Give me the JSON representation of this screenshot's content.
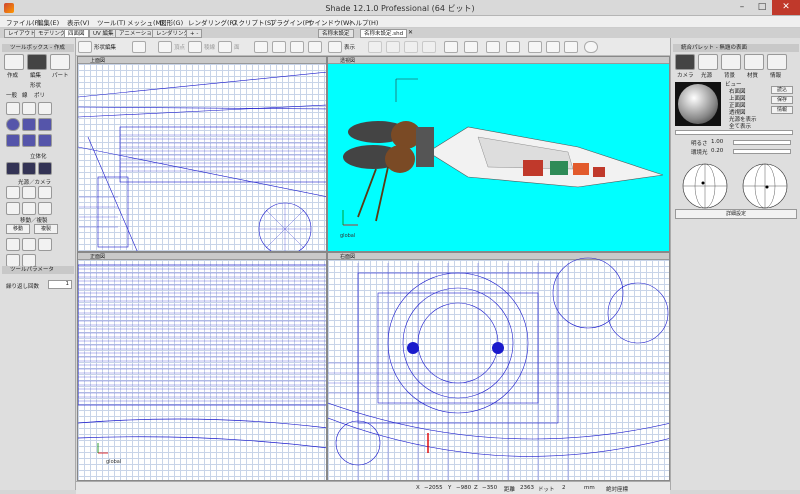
{
  "window": {
    "title": "Shade 12.1.0 Professional (64 ビット)"
  },
  "menu": [
    "ファイル(F)",
    "編集(E)",
    "表示(V)",
    "ツール(T)",
    "メッシュ(M)",
    "図形(G)",
    "レンダリング(R)",
    "スクリプト(S)",
    "プラグイン(P)",
    "ウインドウ(W)",
    "ヘルプ(H)"
  ],
  "tabs": {
    "left": [
      "レイアウト",
      "モデリング",
      "四面図",
      "UV 編集",
      "アニメーション",
      "レンダリング",
      "+ -"
    ],
    "doc": [
      "名称未設定",
      "名称未設定.shd"
    ]
  },
  "toolbar": {
    "shape_edit": "形状編集",
    "top_label": "頂点",
    "edge_label": "稜線",
    "face_label": "面",
    "show_label": "表示"
  },
  "left_panel": {
    "toolbox_title": "ツールボックス - 作成",
    "tabs": [
      "作成",
      "編集",
      "パート"
    ],
    "shape_label": "形状",
    "shape_tabs": [
      "一般",
      "線",
      "ポリ"
    ],
    "solid_label": "立体化",
    "light_camera_label": "光源／カメラ",
    "move_copy_label": "移動／複製",
    "move_btn": "移動",
    "copy_btn": "複製",
    "tool_params_title": "ツールパラメータ",
    "repeat_label": "繰り返し回数",
    "repeat_value": "1"
  },
  "right_panel": {
    "title": "統合パレット - 無題の表面",
    "tabs": [
      "カメラ",
      "光源",
      "背景",
      "材質",
      "情報"
    ],
    "view_label": "ビュー",
    "views": [
      "右面図",
      "上面図",
      "正面図",
      "透視図",
      "光源を表示",
      "全て表示"
    ],
    "buttons": [
      "読込",
      "保存",
      "情報"
    ],
    "brightness_label": "明るさ",
    "brightness_value": "1.00",
    "ambient_label": "環境光",
    "ambient_value": "0.20",
    "detail_button": "詳細設定"
  },
  "viewports": {
    "persp_label": "透視図",
    "front_label": "正面図",
    "top_label": "上面図",
    "right_label": "右面図"
  },
  "status": {
    "x_label": "X",
    "x_value": "−2055",
    "y_label": "Y",
    "y_value": "−980",
    "z_label": "Z",
    "z_value": "−350",
    "dist_label": "距離",
    "dist_value": "2363",
    "dot_label": "ドット",
    "dot_value": "2",
    "unit": "mm",
    "coord_label": "絶対座標"
  },
  "colors": {
    "persp_bg": "#00ffff",
    "wire": "#1a1acc",
    "grid": "#c8d4e8"
  }
}
